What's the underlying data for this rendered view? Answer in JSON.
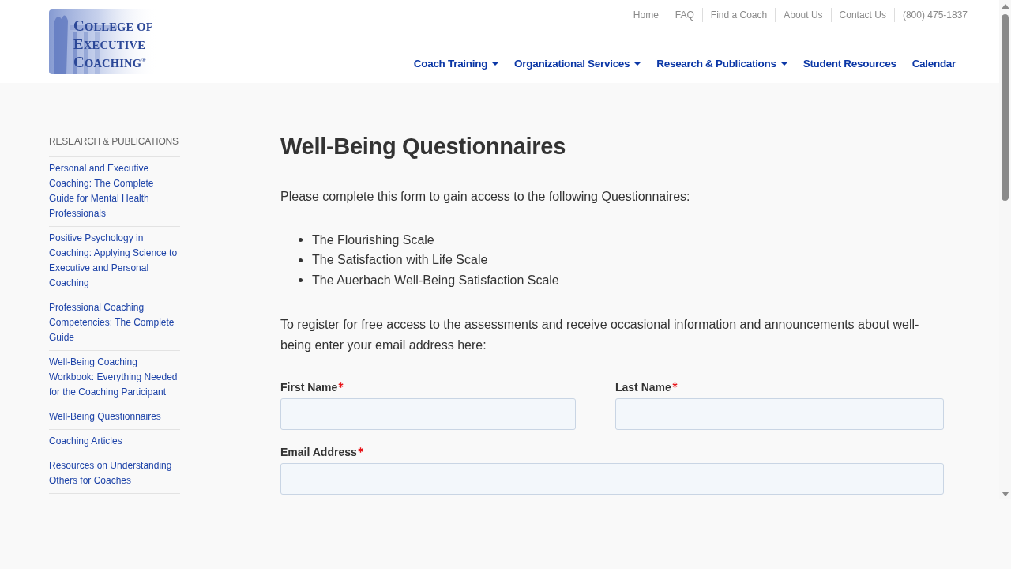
{
  "logo": {
    "lines": [
      "COLLEGE OF",
      "EXECUTIVE",
      "COACHING"
    ],
    "mark": "®"
  },
  "top_links": [
    "Home",
    "FAQ",
    "Find a Coach",
    "About Us",
    "Contact Us",
    "(800) 475-1837"
  ],
  "main_nav": [
    {
      "label": "Coach Training",
      "has_dropdown": true
    },
    {
      "label": "Organizational Services",
      "has_dropdown": true
    },
    {
      "label": "Research & Publications",
      "has_dropdown": true
    },
    {
      "label": "Student Resources",
      "has_dropdown": false
    },
    {
      "label": "Calendar",
      "has_dropdown": false
    }
  ],
  "sidebar": {
    "heading": "RESEARCH & PUBLICATIONS",
    "items": [
      "Personal and Executive Coaching: The Complete Guide for Mental Health Professionals",
      "Positive Psychology in Coaching: Applying Science to Executive and Personal Coaching",
      "Professional Coaching Competencies: The Complete Guide",
      "Well-Being Coaching Workbook: Everything Needed for the Coaching Participant",
      "Well-Being Questionnaires",
      "Coaching Articles",
      "Resources on Understanding Others for Coaches"
    ]
  },
  "content": {
    "title": "Well-Being Questionnaires",
    "intro": "Please complete this form to gain access to the following Questionnaires:",
    "questionnaires": [
      "The Flourishing Scale",
      "The Satisfaction with Life Scale",
      "The Auerbach Well-Being Satisfaction Scale"
    ],
    "register_text": "To register for free access to the assessments and receive occasional information and announcements about well-being enter your email address here:",
    "form": {
      "rows": [
        [
          {
            "label": "First Name",
            "required": true
          },
          {
            "label": "Last Name",
            "required": true
          }
        ],
        [
          {
            "label": "Email Address",
            "required": true
          }
        ]
      ]
    }
  }
}
